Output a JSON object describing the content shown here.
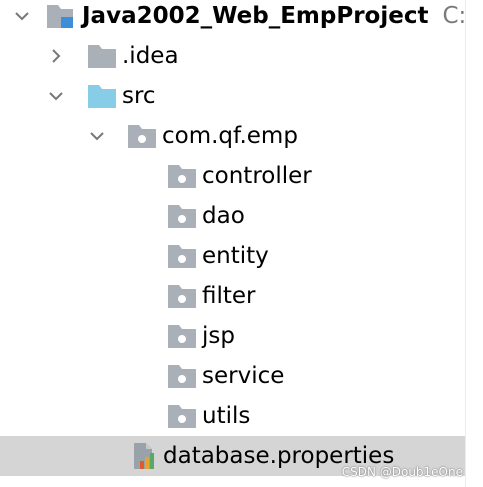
{
  "project_tree": {
    "root": {
      "name": "Java2002_Web_EmpProject",
      "path": "C:\\le"
    },
    "idea_folder": ".idea",
    "src_folder": "src",
    "package": "com.qf.emp",
    "subpackages": [
      "controller",
      "dao",
      "entity",
      "filter",
      "jsp",
      "service",
      "utils"
    ],
    "selected_file": "database.properties"
  },
  "watermark": "CSDN @Doub1eOne",
  "colors": {
    "selection": "#d5d5d5",
    "folder_gray": "#a9b0b7",
    "source_folder_blue": "#87cde8",
    "module_blue": "#3c8ed8"
  }
}
